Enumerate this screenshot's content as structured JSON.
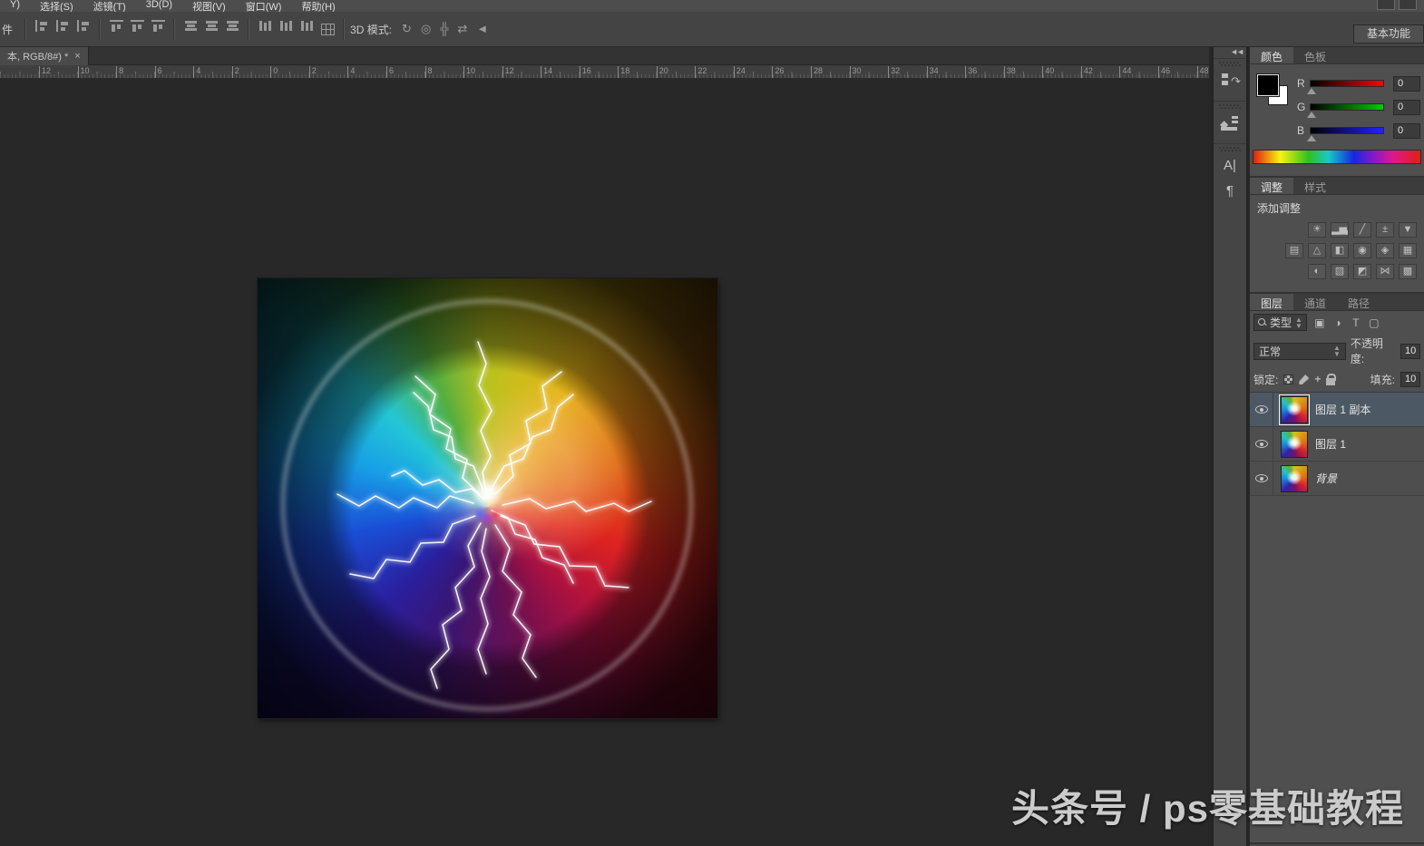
{
  "menu": {
    "items": [
      "Y)",
      "选择(S)",
      "滤镜(T)",
      "3D(D)",
      "视图(V)",
      "窗口(W)",
      "帮助(H)"
    ]
  },
  "options_bar": {
    "left_label": "件",
    "align_icons": [
      "align-left-edges-icon",
      "align-horizontal-centers-icon",
      "align-right-edges-icon",
      "align-top-edges-icon",
      "align-vertical-centers-icon",
      "align-bottom-edges-icon",
      "distribute-top-icon",
      "distribute-vertical-centers-icon",
      "distribute-bottom-icon",
      "distribute-left-icon",
      "distribute-horizontal-centers-icon",
      "distribute-right-icon"
    ],
    "auto_align_icon": "auto-align-layers-icon",
    "mode_label": "3D 模式:",
    "mode_icons": [
      {
        "name": "3d-orbit-icon",
        "glyph": "↻"
      },
      {
        "name": "3d-roll-icon",
        "glyph": "◎"
      },
      {
        "name": "3d-drag-icon",
        "glyph": "╬"
      },
      {
        "name": "3d-slide-icon",
        "glyph": "⇄"
      },
      {
        "name": "3d-camera-icon",
        "glyph": "◄"
      }
    ],
    "workspace_button": "基本功能"
  },
  "document_tab": {
    "title": "本, RGB/8#) *",
    "close": "×"
  },
  "ruler": {
    "labels": [
      "12",
      "10",
      "8",
      "6",
      "4",
      "2",
      "0",
      "2",
      "4",
      "6",
      "8",
      "10",
      "12",
      "14",
      "16",
      "18",
      "20",
      "22",
      "24",
      "26",
      "28",
      "30",
      "32",
      "34",
      "36",
      "38",
      "40",
      "42",
      "44",
      "46",
      "48"
    ]
  },
  "dock": {
    "collapse_arrows": "◄◄",
    "icons": [
      "history-panel-icon",
      "3d-properties-panel-icon",
      "character-panel-icon",
      "paragraph-panel-icon"
    ],
    "character_glyph": "A|",
    "paragraph_glyph": "¶"
  },
  "color_panel": {
    "tabs": [
      "颜色",
      "色板"
    ],
    "channels": [
      {
        "label": "R",
        "value": "0",
        "track": "red"
      },
      {
        "label": "G",
        "value": "0",
        "track": "green"
      },
      {
        "label": "B",
        "value": "0",
        "track": "blue"
      }
    ]
  },
  "adjustments_panel": {
    "tabs": [
      "调整",
      "样式"
    ],
    "add_label": "添加调整",
    "rows": [
      [
        {
          "name": "brightness-contrast-icon",
          "glyph": "☀"
        },
        {
          "name": "levels-icon",
          "glyph": "▂▅▃"
        },
        {
          "name": "curves-icon",
          "glyph": "╱"
        },
        {
          "name": "exposure-icon",
          "glyph": "±"
        },
        {
          "name": "vibrance-icon",
          "glyph": "▼"
        }
      ],
      [
        {
          "name": "hue-saturation-icon",
          "glyph": "▤"
        },
        {
          "name": "color-balance-icon",
          "glyph": "△"
        },
        {
          "name": "black-white-icon",
          "glyph": "◧"
        },
        {
          "name": "photo-filter-icon",
          "glyph": "◉"
        },
        {
          "name": "channel-mixer-icon",
          "glyph": "◈"
        },
        {
          "name": "color-lookup-icon",
          "glyph": "▦"
        }
      ],
      [
        {
          "name": "invert-icon",
          "glyph": "◐"
        },
        {
          "name": "posterize-icon",
          "glyph": "▧"
        },
        {
          "name": "threshold-icon",
          "glyph": "◩"
        },
        {
          "name": "gradient-map-icon",
          "glyph": "⋈"
        },
        {
          "name": "selective-color-icon",
          "glyph": "▩"
        }
      ]
    ]
  },
  "layers_panel": {
    "tabs": [
      "图层",
      "通道",
      "路径"
    ],
    "kind_label": "类型",
    "filter_icons": [
      {
        "name": "filter-pixel-layers-icon",
        "glyph": "▣"
      },
      {
        "name": "filter-adjustment-layers-icon",
        "glyph": "◑"
      },
      {
        "name": "filter-type-layers-icon",
        "glyph": "T"
      },
      {
        "name": "filter-shape-layers-icon",
        "glyph": "▢"
      }
    ],
    "blend_mode": "正常",
    "opacity_label": "不透明度:",
    "opacity_value": "10",
    "lock_label": "锁定:",
    "fill_label": "填充:",
    "fill_value": "10",
    "layers": [
      {
        "name": "图层 1 副本",
        "selected": true,
        "italic": false
      },
      {
        "name": "图层 1",
        "selected": false,
        "italic": false
      },
      {
        "name": "背景",
        "selected": false,
        "italic": true
      }
    ]
  },
  "watermark": "头条号 / ps零基础教程",
  "colors": {
    "panel_bg": "#4f4f4f",
    "pasteboard": "#272727",
    "selected_layer": "#4c5864",
    "accent_red": "#f00",
    "accent_green": "#0c0",
    "accent_blue": "#22f"
  }
}
